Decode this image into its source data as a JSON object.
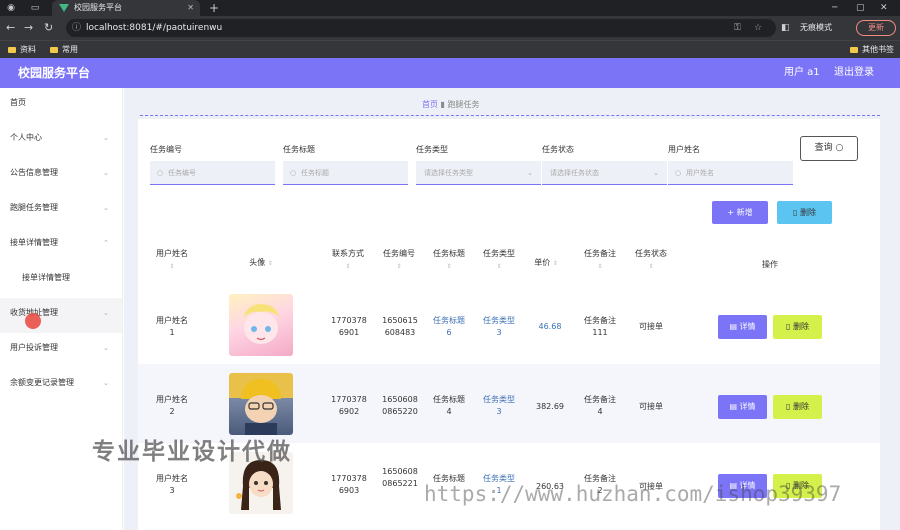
{
  "browser": {
    "tab_title": "校园服务平台",
    "url": "localhost:8081/#/paotuirenwu",
    "incognito_label": "无痕模式",
    "update_label": "更新",
    "bookmarks": [
      "资料",
      "常用"
    ],
    "other_bookmarks": "其他书签"
  },
  "app": {
    "title": "校园服务平台",
    "user_label": "用户 a1",
    "logout_label": "退出登录",
    "accent": "#7b74f7"
  },
  "sidebar": {
    "items": [
      {
        "label": "首页"
      },
      {
        "label": "个人中心"
      },
      {
        "label": "公告信息管理"
      },
      {
        "label": "跑腿任务管理"
      },
      {
        "label": "接单详情管理"
      },
      {
        "label": "接单详情管理"
      },
      {
        "label": "收货地址管理"
      },
      {
        "label": "用户投诉管理"
      },
      {
        "label": "余额变更记录管理"
      }
    ]
  },
  "breadcrumb": {
    "home": "首页",
    "current": "跑腿任务"
  },
  "filters": {
    "task_no_label": "任务编号",
    "task_no_placeholder": "任务编号",
    "task_title_label": "任务标题",
    "task_title_placeholder": "任务标题",
    "task_type_label": "任务类型",
    "task_type_placeholder": "请选择任务类型",
    "task_status_label": "任务状态",
    "task_status_placeholder": "请选择任务状态",
    "user_name_label": "用户姓名",
    "user_name_placeholder": "用户姓名",
    "query_label": "查询"
  },
  "actions": {
    "add_label": "+ 新增",
    "delete_label": "删除"
  },
  "table": {
    "headers": [
      "用户姓名",
      "头像",
      "联系方式",
      "任务编号",
      "任务标题",
      "任务类型",
      "单价",
      "任务备注",
      "任务状态",
      "操作"
    ],
    "detail_label": "详情",
    "delete_label": "删除",
    "rows": [
      {
        "name": "用户姓名\n1",
        "phone": "1770378\n6901",
        "no": "1650615\n608483",
        "title": "任务标题\n6",
        "type": "任务类型\n3",
        "price": "46.68",
        "note": "任务备注\n111",
        "status": "可接单"
      },
      {
        "name": "用户姓名\n2",
        "phone": "1770378\n6902",
        "no": "1650608\n0865220",
        "title": "任务标题\n4",
        "type": "任务类型\n3",
        "price": "382.69",
        "note": "任务备注\n4",
        "status": "可接单"
      },
      {
        "name": "用户姓名\n3",
        "phone": "1770378\n6903",
        "no": "1650608\n0865221",
        "title": "任务标题",
        "type": "任务类型\n1",
        "price": "260.63",
        "note": "任务备注\n2",
        "status": "可接单"
      }
    ]
  },
  "watermark": {
    "text1": "专业毕业设计代做",
    "text2": "https://www.huzhan.com/ishop39397"
  }
}
